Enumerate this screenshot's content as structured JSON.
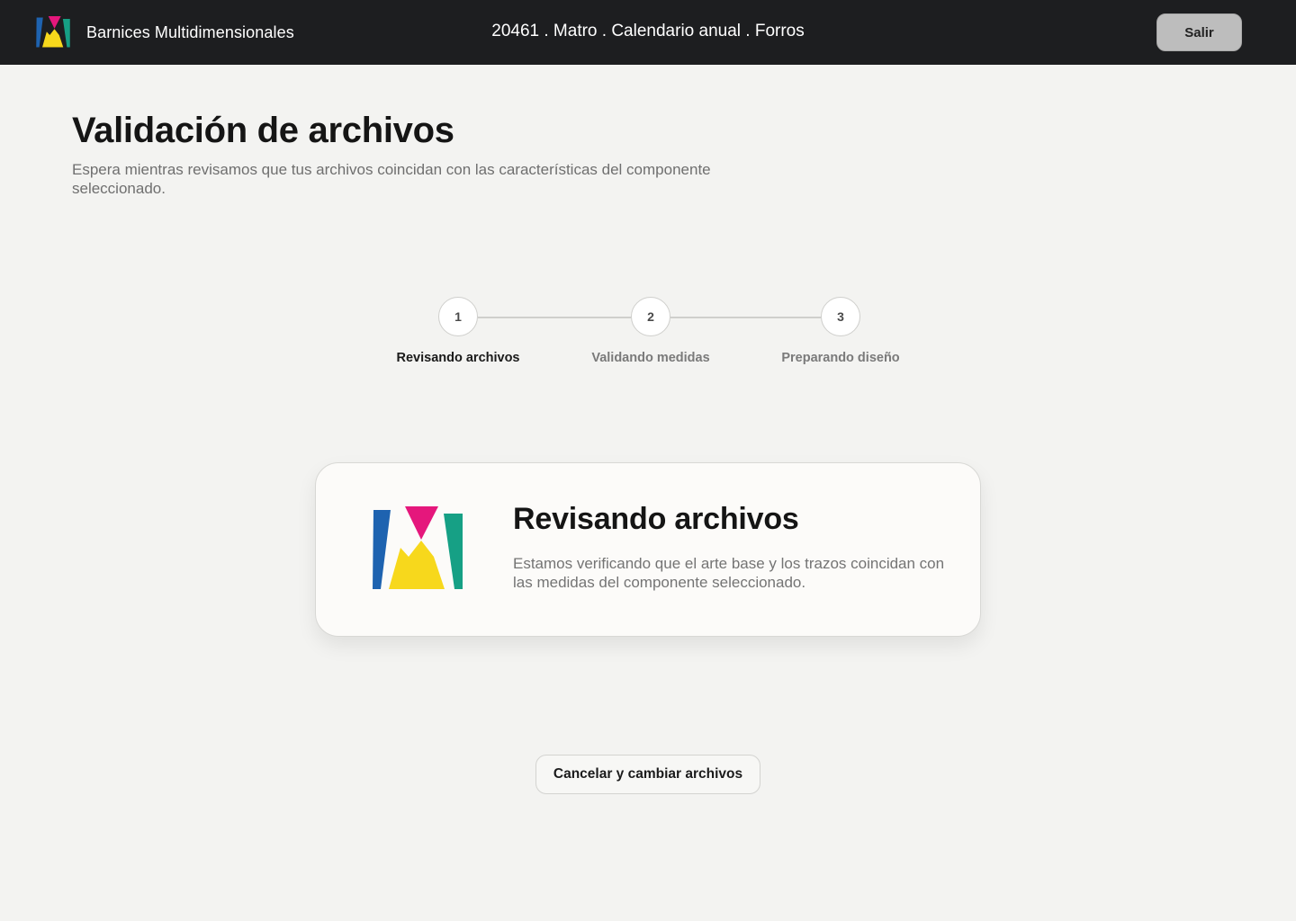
{
  "header": {
    "brand_name": "Barnices Multidimensionales",
    "job_title": "20461 . Matro . Calendario anual . Forros",
    "exit_label": "Salir"
  },
  "page": {
    "title": "Validación de archivos",
    "subtitle": "Espera mientras revisamos que tus archivos coincidan con las características del componente seleccionado."
  },
  "stepper": {
    "active_step": 1,
    "steps": [
      {
        "number": "1",
        "label": "Revisando archivos"
      },
      {
        "number": "2",
        "label": "Validando medidas"
      },
      {
        "number": "3",
        "label": "Preparando diseño"
      }
    ]
  },
  "status_card": {
    "title": "Revisando archivos",
    "text": "Estamos verificando que el arte base y los trazos coincidan con las medidas del componente seleccionado."
  },
  "actions": {
    "cancel_label": "Cancelar y cambiar archivos"
  },
  "colors": {
    "topbar": "#1d1e20",
    "background": "#f3f3f1",
    "logo_blue": "#1e63b0",
    "logo_magenta": "#e5177c",
    "logo_yellow": "#f7d81c",
    "logo_teal": "#16a085"
  },
  "icons": {
    "brand_logo": "brand-m-logo-icon",
    "card_logo": "brand-m-logo-icon"
  }
}
